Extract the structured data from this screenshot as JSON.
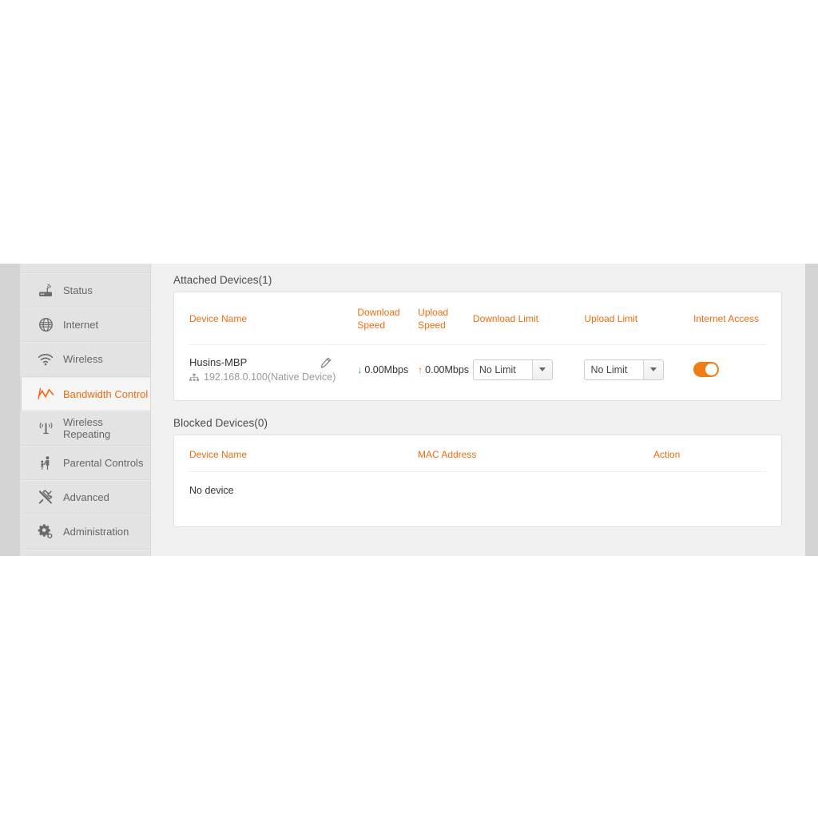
{
  "sidebar": {
    "items": [
      {
        "label": "Status",
        "icon": "router-icon",
        "active": false
      },
      {
        "label": "Internet",
        "icon": "globe-icon",
        "active": false
      },
      {
        "label": "Wireless",
        "icon": "wifi-icon",
        "active": false
      },
      {
        "label": "Bandwidth Control",
        "icon": "bandwidth-chart-icon",
        "active": true
      },
      {
        "label": "Wireless Repeating",
        "icon": "antenna-icon",
        "active": false
      },
      {
        "label": "Parental Controls",
        "icon": "parent-child-icon",
        "active": false
      },
      {
        "label": "Advanced",
        "icon": "tools-icon",
        "active": false
      },
      {
        "label": "Administration",
        "icon": "gear-icon",
        "active": false
      }
    ]
  },
  "attached": {
    "title": "Attached Devices(1)",
    "columns": [
      "Device Name",
      "Download Speed",
      "Upload Speed",
      "Download Limit",
      "Upload Limit",
      "Internet Access"
    ],
    "rows": [
      {
        "device_name": "Husins-MBP",
        "ip_text": "192.168.0.100(Native Device)",
        "download_speed": "0.00Mbps",
        "upload_speed": "0.00Mbps",
        "download_limit": "No Limit",
        "upload_limit": "No Limit",
        "internet_access_on": true
      }
    ]
  },
  "blocked": {
    "title": "Blocked Devices(0)",
    "columns": [
      "Device Name",
      "MAC Address",
      "Action"
    ],
    "empty_text": "No device"
  },
  "colors": {
    "accent": "#ef6c11",
    "toggle_on": "#ef7c14",
    "download_arrow": "#33a02c",
    "upload_arrow": "#ef6c11",
    "sidebar_bg": "#e3e3e3",
    "content_bg": "#f0f0f0"
  }
}
